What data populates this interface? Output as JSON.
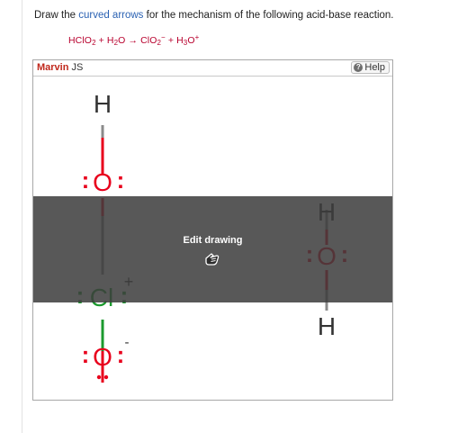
{
  "question": {
    "prefix": "Draw the ",
    "link": "curved arrows",
    "suffix": " for the mechanism of the following acid-base reaction."
  },
  "equation": {
    "reactant1": "HClO",
    "reactant1_sub": "2",
    "plus1": " + ",
    "reactant2": "H",
    "reactant2_sub": "2",
    "reactant2_end": "O",
    "arrow": " → ",
    "product1": "ClO",
    "product1_sub": "2",
    "product1_sup": "−",
    "plus2": " + ",
    "product2": "H",
    "product2_sub": "3",
    "product2_end": "O",
    "product2_sup": "+"
  },
  "editor": {
    "brand": "Marvin",
    "brand_suffix": " JS",
    "help_label": "Help",
    "edit_label": "Edit drawing"
  },
  "molecule": {
    "atoms": {
      "h": "H",
      "o": "O",
      "cl": "Cl",
      "lone_pair": ":",
      "plus": "+",
      "minus": "-"
    }
  },
  "colors": {
    "oxygen": "#e8001c",
    "chlorine": "#1c9a2e",
    "bond": "#8a8a8a",
    "hydrogen": "#333333",
    "accent_red": "#b8002d",
    "link": "#2b62b3"
  }
}
